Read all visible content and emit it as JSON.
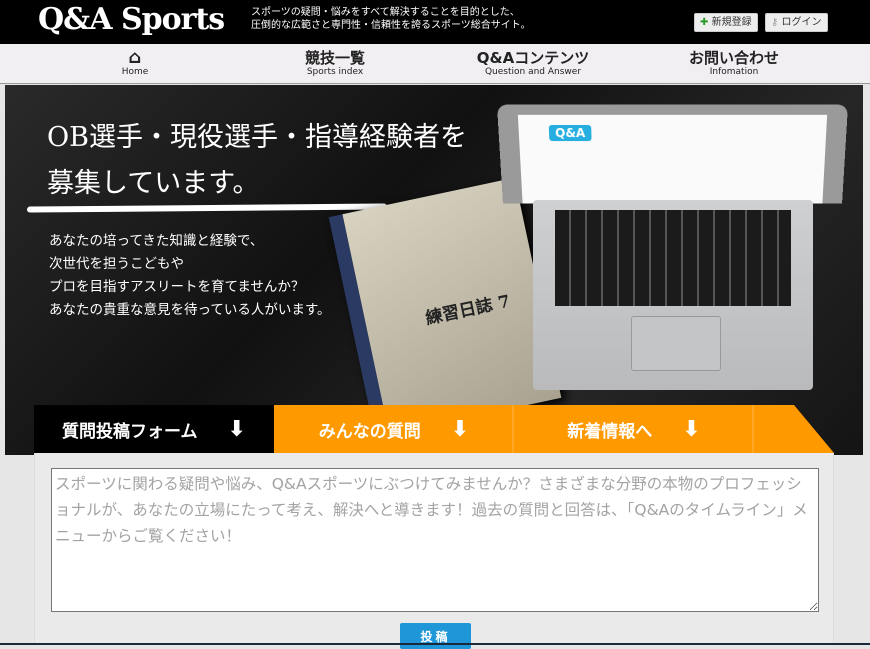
{
  "header": {
    "logo": "Q&A Sports",
    "tagline_line1": "スポーツの疑問・悩みをすべて解決することを目的とした、",
    "tagline_line2": "圧倒的な広範さと専門性・信頼性を誇るスポーツ総合サイト。",
    "register": "新規登録",
    "login": "ログイン"
  },
  "nav": [
    {
      "jp": "",
      "en": "Home",
      "icon": "home-icon"
    },
    {
      "jp": "競技一覧",
      "en": "Sports index"
    },
    {
      "jp": "Q&Aコンテンツ",
      "en": "Question and Answer"
    },
    {
      "jp": "お問い合わせ",
      "en": "Infomation"
    }
  ],
  "hero": {
    "title_line1": "OB選手・現役選手・指導経験者を",
    "title_line2": "募集しています。",
    "body": [
      "あなたの培ってきた知識と経験で、",
      "次世代を担うこどもや",
      "プロを目指すアスリートを育てませんか？",
      "あなたの貴重な意見を待っている人がいます。"
    ],
    "book_label": "練習日誌 7",
    "screen_badge": "Q&A"
  },
  "tabs": [
    {
      "label": "質問投稿フォーム",
      "arrow": "⬇"
    },
    {
      "label": "みんなの質問",
      "arrow": "⬇"
    },
    {
      "label": "新着情報へ",
      "arrow": "⬇"
    }
  ],
  "form": {
    "placeholder": "スポーツに関わる疑問や悩み、Q&Aスポーツにぶつけてみませんか？さまざまな分野の本物のプロフェッショナルが、あなたの立場にたって考え、解決へと導きます！過去の質問と回答は、「Q&Aのタイムライン」メニューからご覧ください！",
    "submit": "投稿"
  },
  "colors": {
    "accent": "#ff9900",
    "button": "#1e96d8"
  }
}
